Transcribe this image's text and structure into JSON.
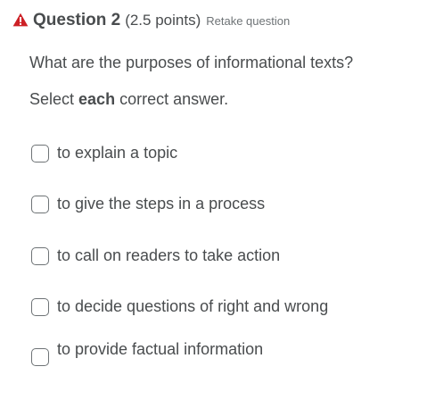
{
  "question": {
    "title": "Question 2",
    "points": "(2.5 points)",
    "retake_label": "Retake question",
    "prompt": "What are the purposes of informational texts?",
    "instruction_prefix": "Select ",
    "instruction_bold": "each",
    "instruction_suffix": " correct answer."
  },
  "options": [
    {
      "label": "to explain a topic",
      "checked": false
    },
    {
      "label": "to give the steps in a process",
      "checked": false
    },
    {
      "label": "to call on readers to take action",
      "checked": false
    },
    {
      "label": "to decide questions of right and wrong",
      "checked": false
    },
    {
      "label": "to provide factual information",
      "checked": false
    }
  ],
  "colors": {
    "warning": "#cd2026",
    "text": "#494c4e",
    "muted": "#6e7376"
  },
  "icons": {
    "header": "warning-triangle-icon"
  }
}
